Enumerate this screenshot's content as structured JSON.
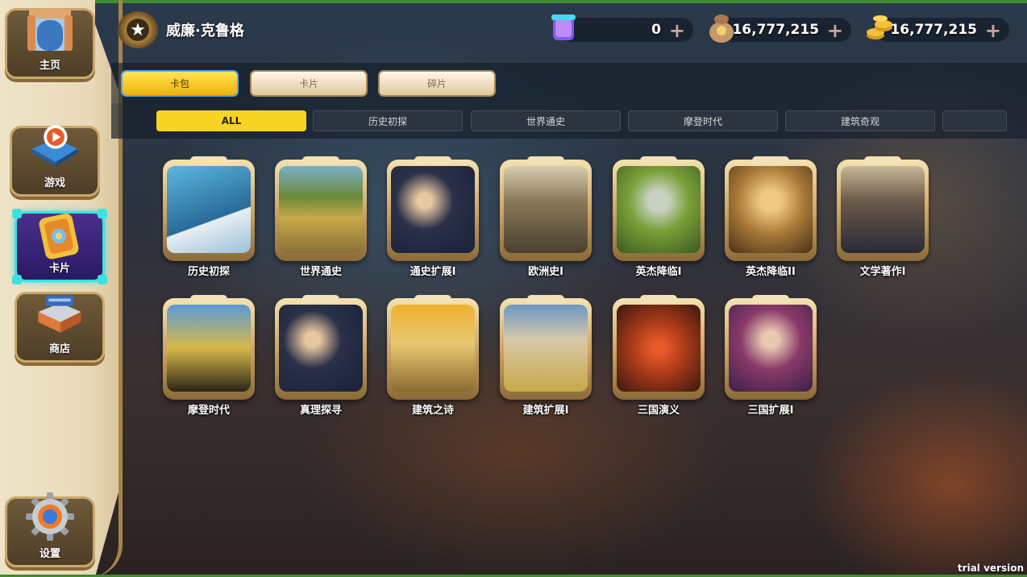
{
  "sidebar": {
    "items": [
      {
        "label": "主页",
        "icon": "home-gate-icon"
      },
      {
        "label": "游戏",
        "icon": "play-book-icon"
      },
      {
        "label": "卡片",
        "icon": "card-icon"
      },
      {
        "label": "商店",
        "icon": "shop-icon"
      },
      {
        "label": "设置",
        "icon": "gear-icon"
      }
    ]
  },
  "player": {
    "name": "威廉·克鲁格",
    "badge_icon": "star-badge-icon"
  },
  "resources": [
    {
      "icon": "gem-jar-icon",
      "value": "0"
    },
    {
      "icon": "coin-bag-icon",
      "value": "16,777,215"
    },
    {
      "icon": "gold-coins-icon",
      "value": "16,777,215"
    }
  ],
  "tabs": [
    "卡包",
    "卡片",
    "碎片"
  ],
  "filters": [
    "ALL",
    "历史初探",
    "世界通史",
    "摩登时代",
    "建筑奇观"
  ],
  "cards": [
    {
      "label": "历史初探"
    },
    {
      "label": "世界通史"
    },
    {
      "label": "通史扩展I"
    },
    {
      "label": "欧洲史I"
    },
    {
      "label": "英杰降临I"
    },
    {
      "label": "英杰降临II"
    },
    {
      "label": "文学著作I"
    },
    {
      "label": "摩登时代"
    },
    {
      "label": "真理探寻"
    },
    {
      "label": "建筑之诗"
    },
    {
      "label": "建筑扩展I"
    },
    {
      "label": "三国演义"
    },
    {
      "label": "三国扩展I"
    }
  ],
  "watermark": "trial version",
  "colors": {
    "accent_yellow": "#f7d424",
    "active_cyan": "#3fe0e0",
    "gold_frame": "#c9a060"
  }
}
